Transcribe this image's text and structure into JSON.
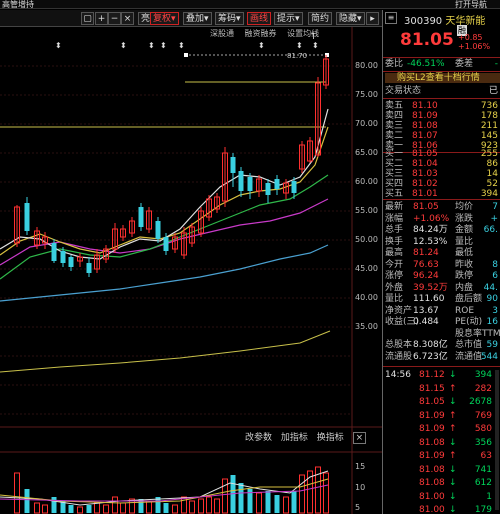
{
  "window": {
    "left_title": "高管增持",
    "right_title": "打开导航"
  },
  "toolbar": {
    "items": [
      "亮点",
      "复权",
      "叠加",
      "筹码",
      "画线",
      "提示",
      "简约",
      "隐藏"
    ],
    "icons": [
      "square-icon",
      "plus-icon",
      "minus-icon",
      "close-icon"
    ]
  },
  "subtoolbar": {
    "items": [
      "深股通",
      "融资融券",
      "设置均线"
    ]
  },
  "peak_label": "81.70",
  "price_axis": [
    "80.00",
    "75.00",
    "70.00",
    "65.00",
    "60.00",
    "55.00",
    "50.00",
    "45.00",
    "40.00",
    "35.00"
  ],
  "vol_axis": [
    "15",
    "10",
    "5"
  ],
  "indicator": {
    "items": [
      "改参数",
      "加指标",
      "换指标"
    ]
  },
  "stock": {
    "code": "300390",
    "name": "天华新能",
    "tag": "融",
    "price": "81.05",
    "change": "+0.85",
    "change_pct": "+1.06%"
  },
  "summary": [
    {
      "label": "委比",
      "value": "-46.51%",
      "label2": "委差",
      "value2": "-"
    },
    {
      "label": "购买L2查看十档行情"
    },
    {
      "label": "交易状态",
      "value": "已"
    }
  ],
  "asks": [
    {
      "label": "卖五",
      "price": "81.10",
      "vol": "736"
    },
    {
      "label": "卖四",
      "price": "81.09",
      "vol": "178"
    },
    {
      "label": "卖三",
      "price": "81.08",
      "vol": "211"
    },
    {
      "label": "卖二",
      "price": "81.07",
      "vol": "145"
    },
    {
      "label": "卖一",
      "price": "81.06",
      "vol": "923"
    }
  ],
  "bids": [
    {
      "label": "买一",
      "price": "81.05",
      "vol": "255"
    },
    {
      "label": "买二",
      "price": "81.04",
      "vol": "86"
    },
    {
      "label": "买三",
      "price": "81.03",
      "vol": "14"
    },
    {
      "label": "买四",
      "price": "81.02",
      "vol": "52"
    },
    {
      "label": "买五",
      "price": "81.01",
      "vol": "394"
    }
  ],
  "quote": [
    {
      "l": "最新",
      "v": "81.05",
      "l2": "均价",
      "v2": "7"
    },
    {
      "l": "涨幅",
      "v": "+1.06%",
      "l2": "涨跌",
      "v2": "+"
    },
    {
      "l": "总手",
      "v": "84.24万",
      "l2": "金额",
      "v2": "66."
    },
    {
      "l": "换手",
      "v": "12.53%",
      "l2": "量比",
      "v2": ""
    },
    {
      "l": "最高",
      "v": "81.24",
      "l2": "最低",
      "v2": ""
    },
    {
      "l": "今开",
      "v": "76.63",
      "l2": "昨收",
      "v2": "8"
    },
    {
      "l": "涨停",
      "v": "96.24",
      "l2": "跌停",
      "v2": "6"
    },
    {
      "l": "外盘",
      "v": "39.52万",
      "l2": "内盘",
      "v2": "44."
    },
    {
      "l": "量比",
      "v": "111.60",
      "l2": "盘后额",
      "v2": "90"
    },
    {
      "l": "净资产",
      "v": "13.67",
      "l2": "ROE",
      "v2": "3"
    },
    {
      "l": "收益(三)",
      "v": "0.484",
      "l2": "PE(动)",
      "v2": "16"
    },
    {
      "l": "",
      "v": "",
      "l2": "股息率TTM",
      "v2": ""
    },
    {
      "l": "总股本",
      "v": "8.308亿",
      "l2": "总市值",
      "v2": "59"
    },
    {
      "l": "流通股",
      "v": "6.723亿",
      "l2": "流通值",
      "v2": "544"
    }
  ],
  "ticks": [
    {
      "t": "14:56",
      "p": "81.12",
      "d": "down",
      "v": "394"
    },
    {
      "t": "",
      "p": "81.15",
      "d": "up",
      "v": "282"
    },
    {
      "t": "",
      "p": "81.05",
      "d": "down",
      "v": "2678"
    },
    {
      "t": "",
      "p": "81.09",
      "d": "up",
      "v": "769"
    },
    {
      "t": "",
      "p": "81.09",
      "d": "up",
      "v": "580"
    },
    {
      "t": "",
      "p": "81.08",
      "d": "down",
      "v": "356"
    },
    {
      "t": "",
      "p": "81.09",
      "d": "up",
      "v": "63"
    },
    {
      "t": "",
      "p": "81.08",
      "d": "down",
      "v": "741"
    },
    {
      "t": "",
      "p": "81.08",
      "d": "down",
      "v": "612"
    },
    {
      "t": "",
      "p": "81.00",
      "d": "down",
      "v": "1"
    },
    {
      "t": "",
      "p": "81.00",
      "d": "down",
      "v": "179"
    }
  ]
}
